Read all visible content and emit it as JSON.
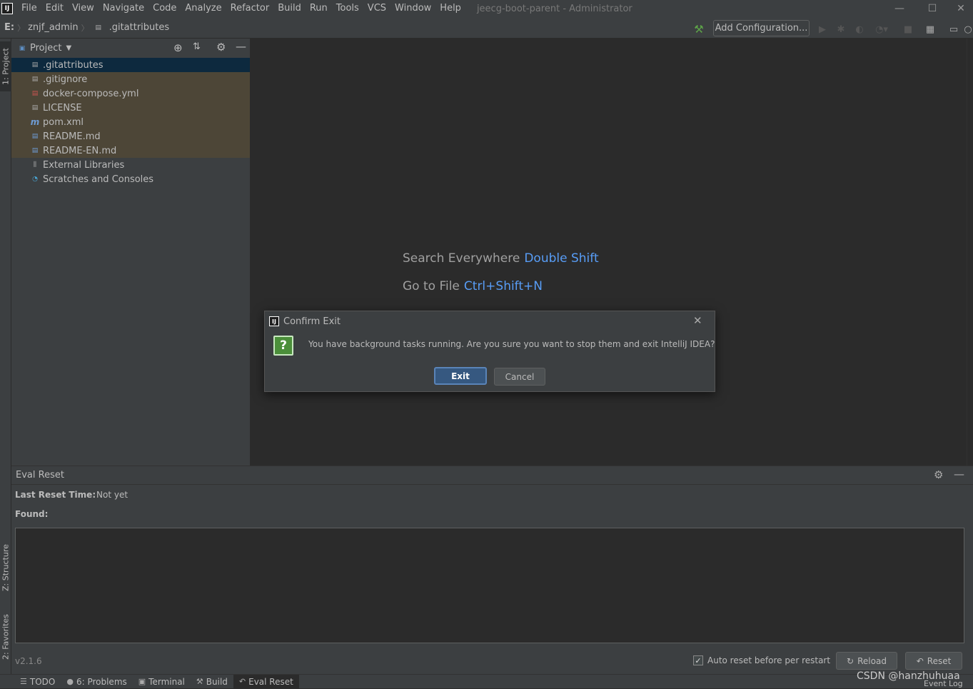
{
  "window": {
    "title": "jeecg-boot-parent - Administrator"
  },
  "menu": [
    {
      "label": "File"
    },
    {
      "label": "Edit"
    },
    {
      "label": "View"
    },
    {
      "label": "Navigate"
    },
    {
      "label": "Code"
    },
    {
      "label": "Analyze"
    },
    {
      "label": "Refactor"
    },
    {
      "label": "Build"
    },
    {
      "label": "Run"
    },
    {
      "label": "Tools"
    },
    {
      "label": "VCS"
    },
    {
      "label": "Window"
    },
    {
      "label": "Help"
    }
  ],
  "breadcrumb": {
    "drive": "E:",
    "folder": "znjf_admin",
    "file": ".gitattributes"
  },
  "toolbar": {
    "add_config": "Add Configuration..."
  },
  "sidebar": {
    "project_tab": "1: Project",
    "structure_tab": "Z: Structure",
    "favorites_tab": "2: Favorites"
  },
  "project": {
    "title": "Project",
    "items": [
      {
        "label": ".gitattributes"
      },
      {
        "label": ".gitignore"
      },
      {
        "label": "docker-compose.yml"
      },
      {
        "label": "LICENSE"
      },
      {
        "label": "pom.xml"
      },
      {
        "label": "README.md"
      },
      {
        "label": "README-EN.md"
      },
      {
        "label": "External Libraries"
      },
      {
        "label": "Scratches and Consoles"
      }
    ]
  },
  "editor": {
    "hints": [
      {
        "label": "Search Everywhere",
        "key": "Double Shift"
      },
      {
        "label": "Go to File",
        "key": "Ctrl+Shift+N"
      }
    ]
  },
  "dialog": {
    "title": "Confirm Exit",
    "message": "You have background tasks running. Are you sure you want to stop them and exit IntelliJ IDEA?",
    "exit_label": "Exit",
    "cancel_label": "Cancel"
  },
  "eval_reset": {
    "title": "Eval Reset",
    "last_reset_label": "Last Reset Time:",
    "last_reset_value": "Not yet",
    "found_label": "Found:",
    "version": "v2.1.6",
    "auto_reset_label": "Auto reset before per restart",
    "auto_reset_checked": true,
    "reload_label": "Reload",
    "reset_label": "Reset"
  },
  "statusbar": {
    "tabs": [
      {
        "label": "TODO"
      },
      {
        "label": "6: Problems"
      },
      {
        "label": "Terminal"
      },
      {
        "label": "Build"
      },
      {
        "label": "Eval Reset"
      }
    ],
    "event_log": "Event Log",
    "watermark": "CSDN @hanzhuhuaa"
  },
  "colors": {
    "accent_link": "#589df6",
    "selection": "#0d293e",
    "ignored": "#4d4637"
  }
}
